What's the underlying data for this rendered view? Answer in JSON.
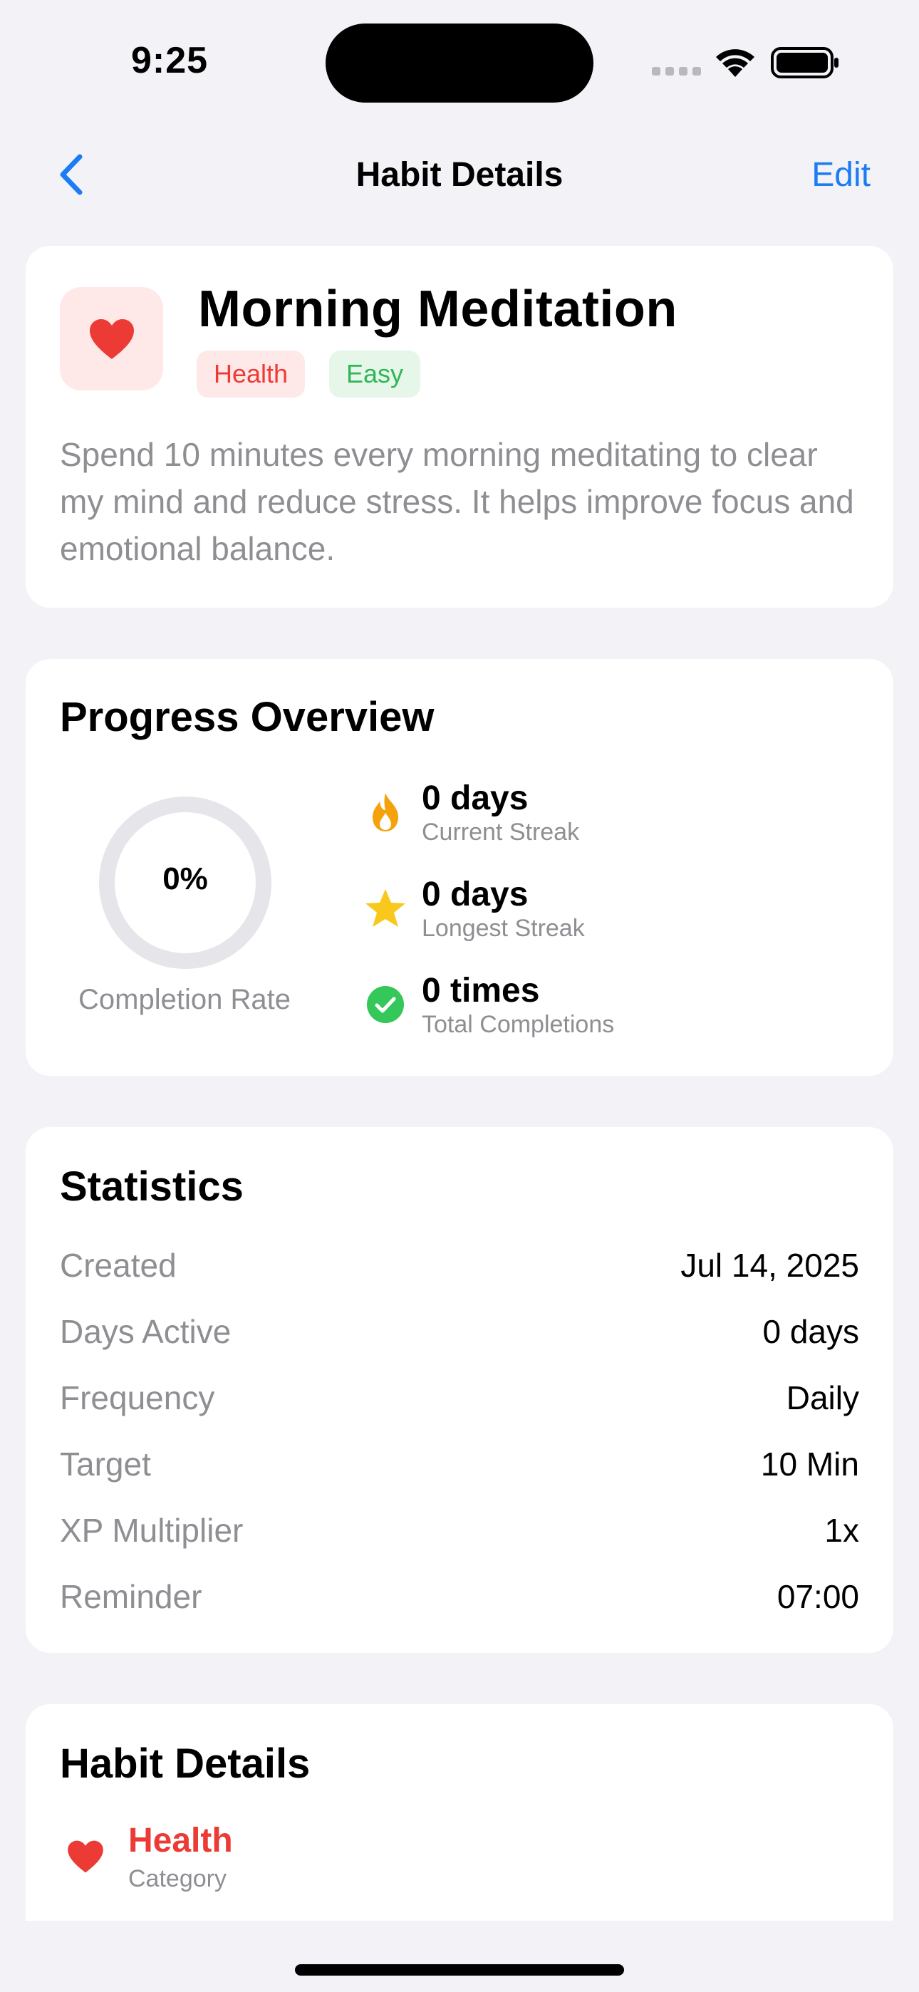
{
  "status_bar": {
    "time": "9:25"
  },
  "nav": {
    "title": "Habit Details",
    "edit_label": "Edit"
  },
  "habit": {
    "name": "Morning Meditation",
    "tags": [
      "Health",
      "Easy"
    ],
    "description": "Spend 10 minutes every morning meditating to clear my mind and reduce stress. It helps improve focus and emotional balance."
  },
  "progress": {
    "header": "Progress Overview",
    "completion_value": "0%",
    "completion_fraction": 0,
    "completion_label": "Completion Rate",
    "stats": [
      {
        "value": "0 days",
        "label": "Current Streak",
        "icon": "flame-icon"
      },
      {
        "value": "0 days",
        "label": "Longest Streak",
        "icon": "star-icon"
      },
      {
        "value": "0 times",
        "label": "Total Completions",
        "icon": "checkmark-circle-icon"
      }
    ]
  },
  "statistics": {
    "header": "Statistics",
    "rows": [
      {
        "key": "Created",
        "value": "Jul 14, 2025"
      },
      {
        "key": "Days Active",
        "value": "0 days"
      },
      {
        "key": "Frequency",
        "value": "Daily"
      },
      {
        "key": "Target",
        "value": "10 Min"
      },
      {
        "key": "XP Multiplier",
        "value": "1x"
      },
      {
        "key": "Reminder",
        "value": "07:00"
      }
    ]
  },
  "details": {
    "header": "Habit Details",
    "category_value": "Health",
    "category_label": "Category"
  },
  "colors": {
    "accent": "#1c7cf3",
    "health_red": "#ec3b35",
    "easy_green": "#31b556",
    "flame_orange": "#f5a20a",
    "star_yellow": "#f8c81c",
    "check_green": "#34c759",
    "background": "#f2f2f7"
  }
}
